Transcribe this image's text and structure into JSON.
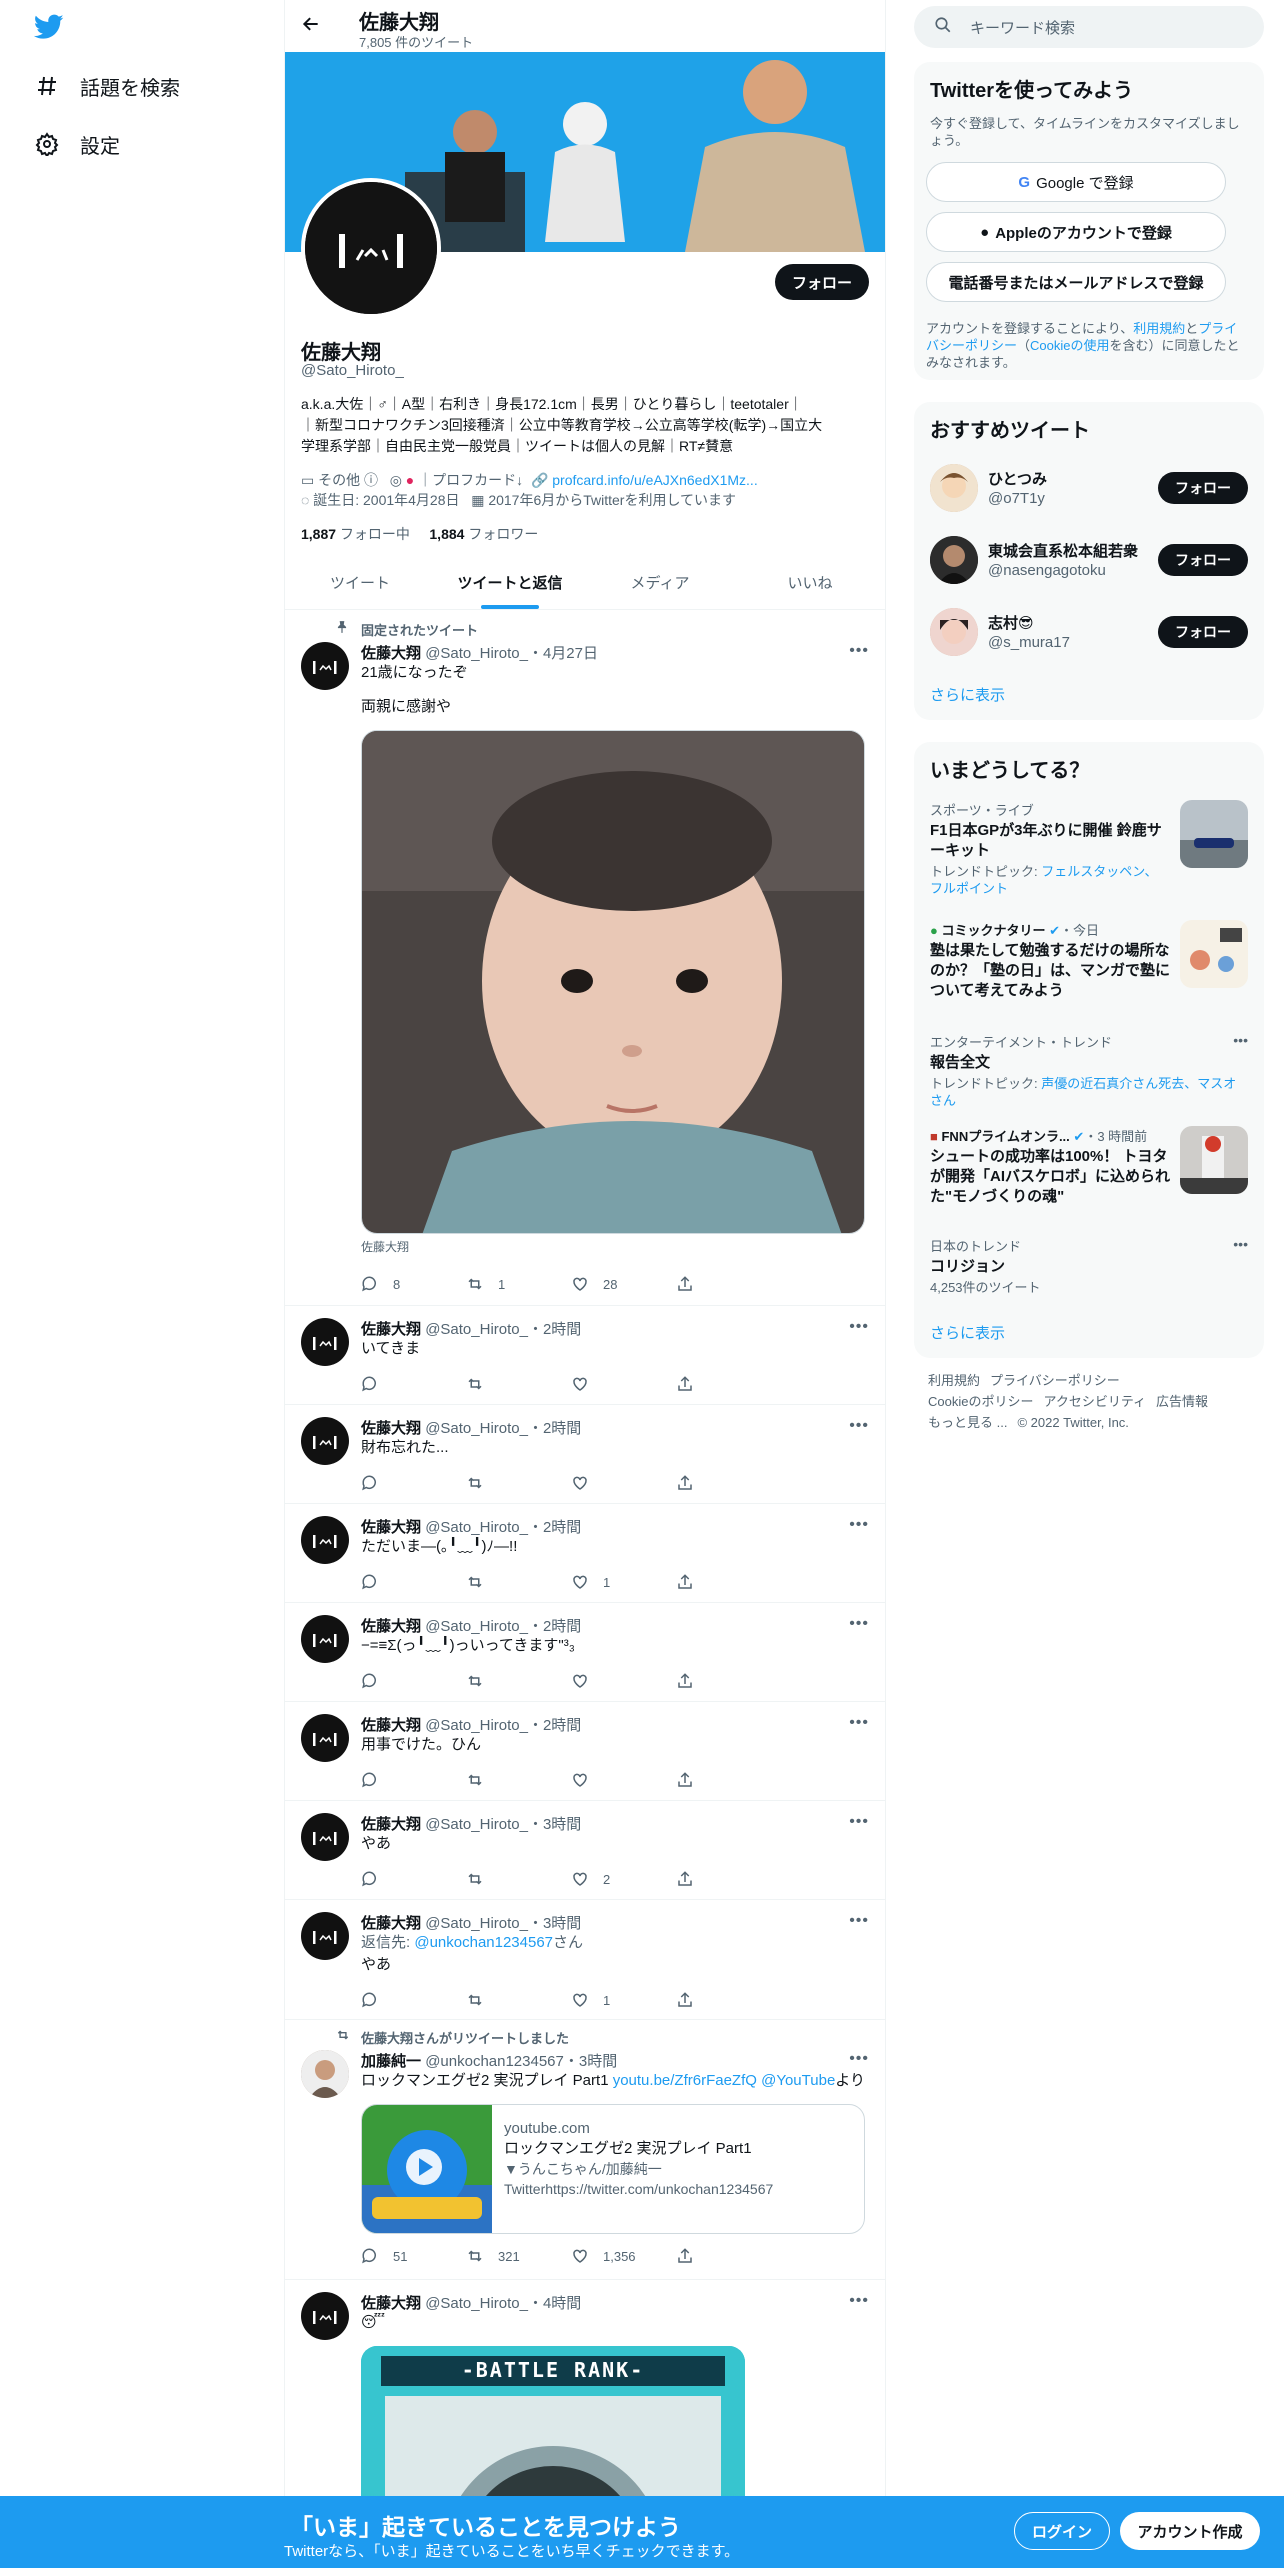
{
  "nav": {
    "explore_label": "話題を検索",
    "settings_label": "設定"
  },
  "profile": {
    "name": "佐藤大翔",
    "tweet_count": "7,805 件のツイート",
    "handle": "@Sato_Hiroto_",
    "follow_label": "フォロー",
    "bio_line1": "a.k.a.大佐｜♂｜A型｜右利き｜身長172.1cm｜長男｜ひとり暮らし｜teetotaler｜",
    "bio_line2": "｜新型コロナワクチン3回接種済｜公立中等教育学校→公立高等学校(転学)→国立大",
    "bio_line3": "学理系学部｜自由民主党一般党員｜ツイートは個人の見解｜RT≠賛意",
    "meta_other": "その他",
    "meta_profcard_label": "プロフカード↓",
    "meta_link": "profcard.info/u/eAJXn6edX1Mz...",
    "meta_birthday": "誕生日: 2001年4月28日",
    "meta_joined": "2017年6月からTwitterを利用しています",
    "following_count": "1,887",
    "following_label": "フォロー中",
    "followers_count": "1,884",
    "followers_label": "フォロワー"
  },
  "tabs": [
    "ツイート",
    "ツイートと返信",
    "メディア",
    "いいね"
  ],
  "pinned_label": "固定されたツイート",
  "pinned_tweet": {
    "name": "佐藤大翔",
    "handle": "@Sato_Hiroto_",
    "time": "・4月27日",
    "line1": "21歳になったぞ",
    "line2": "両親に感謝や",
    "caption": "佐藤大翔",
    "replies": "8",
    "retweets": "1",
    "likes": "28"
  },
  "tweets": [
    {
      "name": "佐藤大翔",
      "handle": "@Sato_Hiroto_",
      "time": "・2時間",
      "text": "いてきま",
      "likes": ""
    },
    {
      "name": "佐藤大翔",
      "handle": "@Sato_Hiroto_",
      "time": "・2時間",
      "text": "財布忘れた...",
      "likes": ""
    },
    {
      "name": "佐藤大翔",
      "handle": "@Sato_Hiroto_",
      "time": "・2時間",
      "text": "ただいま—(｡╹﹏╹)ﾉ—!!",
      "likes": "1"
    },
    {
      "name": "佐藤大翔",
      "handle": "@Sato_Hiroto_",
      "time": "・2時間",
      "text": "−=≡Σ(っ╹﹏╹)っいってきます\"³₃",
      "likes": ""
    },
    {
      "name": "佐藤大翔",
      "handle": "@Sato_Hiroto_",
      "time": "・2時間",
      "text": "用事でけた。ひん",
      "likes": ""
    },
    {
      "name": "佐藤大翔",
      "handle": "@Sato_Hiroto_",
      "time": "・3時間",
      "text": "やあ",
      "likes": "2"
    },
    {
      "name": "佐藤大翔",
      "handle": "@Sato_Hiroto_",
      "time": "・3時間",
      "reply_prefix": "返信先: ",
      "reply_to": "@unkochan1234567",
      "reply_suffix": "さん",
      "text": "やあ",
      "likes": "1"
    }
  ],
  "retweet": {
    "social": "佐藤大翔さんがリツイートしました",
    "name": "加藤純一",
    "handle": "@unkochan1234567",
    "time": "・3時間",
    "text": "ロックマンエグゼ2 実況プレイ Part1 ",
    "link1": "youtu.be/Zfr6rFaeZfQ",
    "link2": "@YouTube",
    "suffix": "より",
    "card_domain": "youtube.com",
    "card_title": "ロックマンエグゼ2 実況プレイ Part1",
    "card_desc1": "▼うんこちゃん/加藤純一",
    "card_desc2": "Twitterhttps://twitter.com/unkochan1234567",
    "replies": "51",
    "retweets": "321",
    "likes": "1,356"
  },
  "last_tweet": {
    "name": "佐藤大翔",
    "handle": "@Sato_Hiroto_",
    "time": "・4時間",
    "text": "😴",
    "image_text": "-BATTLE RANK-"
  },
  "search": {
    "placeholder": "キーワード検索"
  },
  "signup_card": {
    "title": "Twitterを使ってみよう",
    "sub": "今すぐ登録して、タイムラインをカスタマイズしましょう。",
    "google": "Google で登録",
    "apple": "Appleのアカウントで登録",
    "phone": "電話番号またはメールアドレスで登録",
    "legal_1": "アカウントを登録することにより、",
    "legal_terms": "利用規約",
    "legal_and": "と",
    "legal_privacy": "プライバシーポリシー",
    "legal_2": "（",
    "legal_cookie": "Cookieの使用",
    "legal_3": "を含む）に同意したとみなされます。"
  },
  "recommend": {
    "title": "おすすめツイート",
    "users": [
      {
        "name": "ひとつみ",
        "handle": "@o7T1y"
      },
      {
        "name": "東城会直系松本組若衆",
        "handle": "@nasengagotoku"
      },
      {
        "name": "志村😎",
        "handle": "@s_mura17"
      }
    ],
    "follow_label": "フォロー",
    "more": "さらに表示"
  },
  "trends": {
    "title": "いまどうしてる？",
    "items": [
      {
        "ctx": "スポーツ・ライブ",
        "title": "F1日本GPが3年ぶりに開催 鈴鹿サーキット",
        "sub_prefix": "トレンドトピック: ",
        "sub_link": "フェルスタッペン、フルポイント"
      },
      {
        "ctx_name": "コミックナタリー",
        "ctx_time": "・今日",
        "title": "塾は果たして勉強するだけの場所なのか？「塾の日」は、マンガで塾について考えてみよう"
      },
      {
        "ctx": "エンターテイメント・トレンド",
        "title": "報告全文",
        "sub_prefix": "トレンドトピック: ",
        "sub_link": "声優の近石真介さん死去、マスオさん"
      },
      {
        "ctx_name": "FNNプライムオンラ...",
        "ctx_time": "・3 時間前",
        "title": "シュートの成功率は100%！ トヨタが開発「AIバスケロボ」に込められた\"モノづくりの魂\""
      },
      {
        "ctx": "日本のトレンド",
        "title": "コリジョン",
        "sub": "4,253件のツイート"
      }
    ],
    "more": "さらに表示"
  },
  "footer": {
    "terms": "利用規約",
    "privacy": "プライバシーポリシー",
    "cookie": "Cookieのポリシー",
    "access": "アクセシビリティ",
    "ads": "広告情報",
    "more": "もっと見る ...",
    "copyright": "© 2022 Twitter, Inc."
  },
  "bottom_bar": {
    "title": "「いま」起きていることを見つけよう",
    "sub": "Twitterなら、「いま」起きていることをいち早くチェックできます。",
    "login": "ログイン",
    "signup": "アカウント作成"
  },
  "colors": {
    "accent": "#1d9bf0",
    "text": "#0f1419",
    "muted": "#536471",
    "banner": "#1fa2e8"
  }
}
